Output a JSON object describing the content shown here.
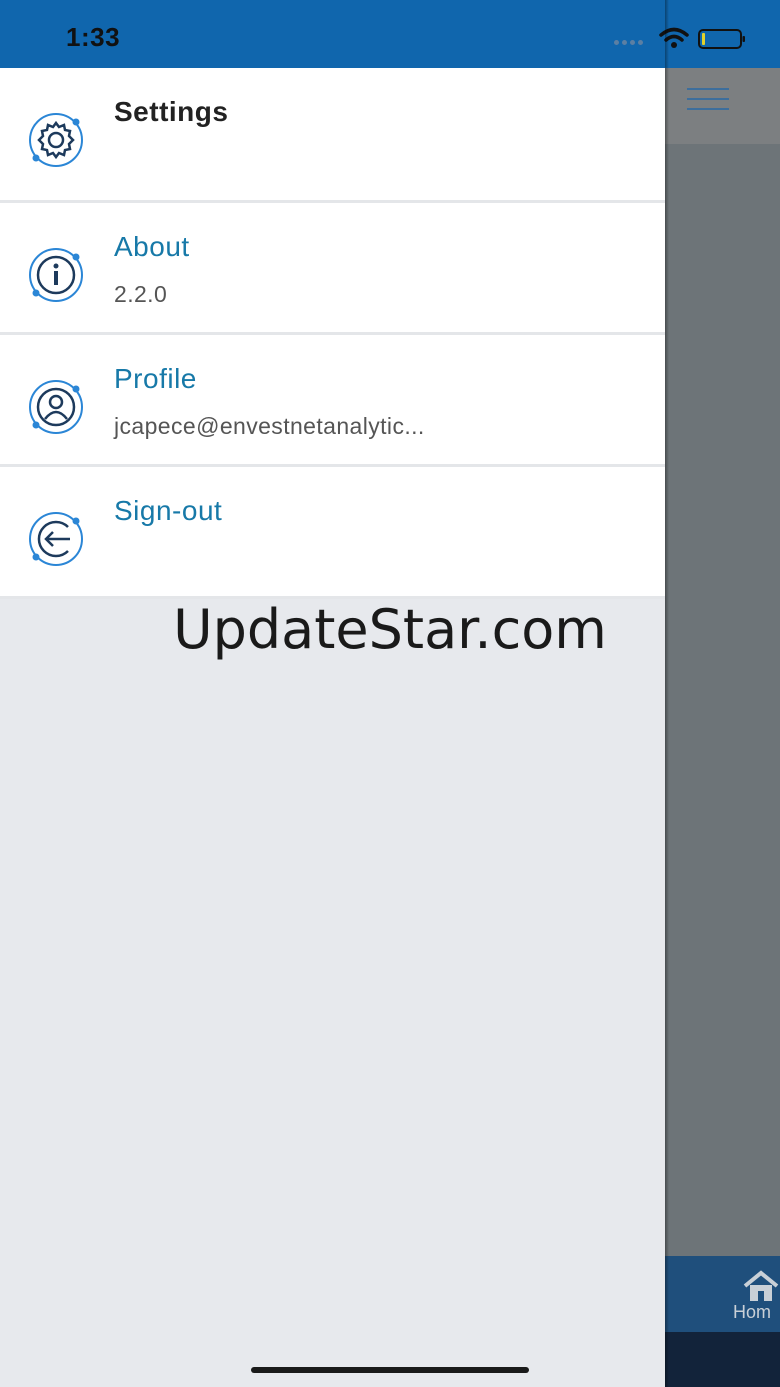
{
  "status_bar": {
    "time": "1:33"
  },
  "drawer": {
    "items": [
      {
        "title": "Settings",
        "subtitle": "",
        "icon": "gear-icon"
      },
      {
        "title": "About",
        "subtitle": "2.2.0",
        "icon": "info-icon"
      },
      {
        "title": "Profile",
        "subtitle": "jcapece@envestnetanalytic...",
        "icon": "user-icon"
      },
      {
        "title": "Sign-out",
        "subtitle": "",
        "icon": "sign-out-icon"
      }
    ]
  },
  "background_page": {
    "tab_home_label": "Hom"
  },
  "watermark": "UpdateStar.com",
  "colors": {
    "status_bar_bg": "#1066ad",
    "accent_text": "#1779a8",
    "icon_blue": "#2b86d6",
    "drawer_bg": "#e7e9ed"
  }
}
